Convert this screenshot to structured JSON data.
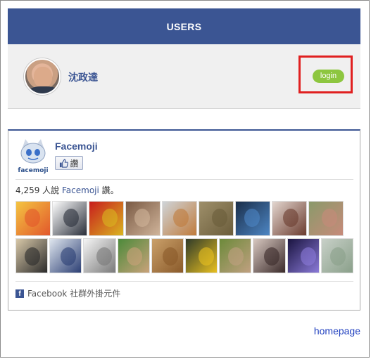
{
  "header": {
    "title": "USERS"
  },
  "user": {
    "name": "沈政達",
    "login_label": "login"
  },
  "fb_widget": {
    "page_name": "Facemoji",
    "logo_text": "facemoji",
    "like_label": "讚",
    "count_prefix": "4,259 人說",
    "count_page": "Facemoji",
    "count_suffix": "讚。",
    "footer": "Facebook 社群外掛元件",
    "fan_rows": [
      [
        {
          "c1": "#f4c542",
          "c2": "#e2572b"
        },
        {
          "c1": "#ffffff",
          "c2": "#2a2f3a"
        },
        {
          "c1": "#c81d1d",
          "c2": "#d9b520"
        },
        {
          "c1": "#7a5a44",
          "c2": "#d0b49a"
        },
        {
          "c1": "#cfd4d8",
          "c2": "#c07b3c"
        },
        {
          "c1": "#9e8f6a",
          "c2": "#6b5d3b"
        },
        {
          "c1": "#1a2e4a",
          "c2": "#4d86c4"
        },
        {
          "c1": "#e3d6cf",
          "c2": "#6b3c2f"
        },
        {
          "c1": "#8a9a6a",
          "c2": "#c78a7a"
        }
      ],
      [
        {
          "c1": "#d8c8a8",
          "c2": "#2b2b2b"
        },
        {
          "c1": "#dfe6ee",
          "c2": "#2c3f74"
        },
        {
          "c1": "#f5f5f5",
          "c2": "#7a7a7a"
        },
        {
          "c1": "#4c8a3a",
          "c2": "#c9a27a"
        },
        {
          "c1": "#caa06a",
          "c2": "#8a5a2a"
        },
        {
          "c1": "#2f3a2a",
          "c2": "#e8c020"
        },
        {
          "c1": "#6c8a3a",
          "c2": "#c0a080"
        },
        {
          "c1": "#d8c8c0",
          "c2": "#3a2a2a"
        },
        {
          "c1": "#1a1440",
          "c2": "#8a7ad8"
        },
        {
          "c1": "#c8d0c8",
          "c2": "#8aa08a"
        }
      ]
    ]
  },
  "links": {
    "homepage": "homepage"
  }
}
